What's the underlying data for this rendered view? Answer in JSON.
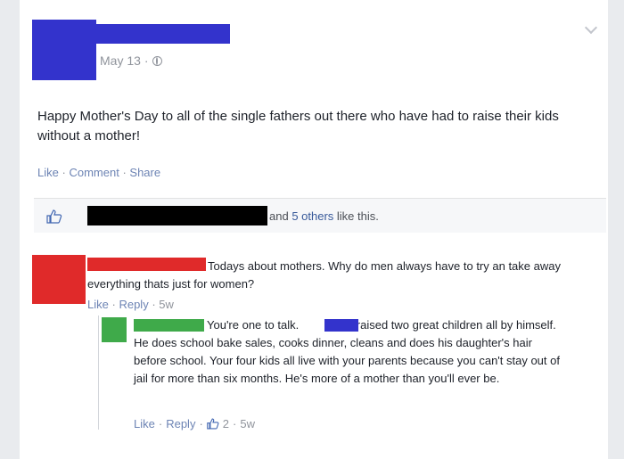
{
  "post": {
    "date": "May 13",
    "text": "Happy Mother's Day to all of the single fathers out there who have had to raise their kids without a mother!",
    "actions": {
      "like": "Like",
      "comment": "Comment",
      "share": "Share",
      "separator": "·"
    }
  },
  "likes": {
    "text_prefix": "and ",
    "others": "5 others",
    "text_suffix": " like this."
  },
  "comments": [
    {
      "text": "Todays about mothers. Why do men always have to try an take away everything thats just for women?",
      "actions": {
        "like": "Like",
        "reply": "Reply",
        "age": "5w"
      }
    },
    {
      "text_before": "You're one to talk.",
      "text_after": "'s raised two great children all by himself. He does school bake sales, cooks dinner, cleans and does his daughter's hair before school. Your four kids all live with your parents because you can't stay out of jail for more than six months. He's more of a mother than you'll ever be.",
      "actions": {
        "like": "Like",
        "reply": "Reply",
        "like_count": "2",
        "age": "5w"
      }
    }
  ],
  "colors": {
    "redaction_blue": "#3333cc",
    "redaction_red": "#e02a2a",
    "redaction_green": "#3faa4a",
    "redaction_black": "#000000",
    "link": "#6d84b4"
  }
}
